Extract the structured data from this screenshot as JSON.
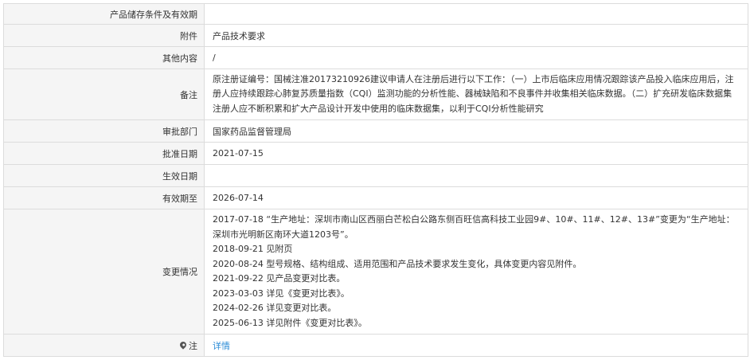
{
  "rows": [
    {
      "label": "产品储存条件及有效期",
      "value": ""
    },
    {
      "label": "附件",
      "value": "产品技术要求"
    },
    {
      "label": "其他内容",
      "value": "/"
    },
    {
      "label": "备注",
      "value": "原注册证编号：国械注准20173210926建议申请人在注册后进行以下工作：（一）上市后临床应用情况跟踪该产品投入临床应用后，注册人应持续跟踪心肺复苏质量指数（CQI）监测功能的分析性能、器械缺陷和不良事件并收集相关临床数据。（二）扩充研发临床数据集注册人应不断积累和扩大产品设计开发中使用的临床数据集，以利于CQI分析性能研究"
    },
    {
      "label": "审批部门",
      "value": "国家药品监督管理局"
    },
    {
      "label": "批准日期",
      "value": "2021-07-15"
    },
    {
      "label": "生效日期",
      "value": ""
    },
    {
      "label": "有效期至",
      "value": "2026-07-14"
    }
  ],
  "changes": {
    "label": "变更情况",
    "lines": [
      "2017-07-18 “生产地址：深圳市南山区西丽白芒松白公路东侧百旺信高科技工业园9#、10#、11#、12#、13#”变更为“生产地址：深圳市光明新区南环大道1203号”。",
      "2018-09-21 见附页",
      "2020-08-24 型号规格、结构组成、适用范围和产品技术要求发生变化，具体变更内容见附件。",
      "2021-09-22 见产品变更对比表。",
      "2023-03-03 详见《变更对比表》。",
      "2024-02-26 详见变更对比表。",
      "2025-06-13 详见附件《变更对比表》。"
    ]
  },
  "note": {
    "label": "注",
    "link": "详情",
    "icon": "location-pin-icon"
  }
}
